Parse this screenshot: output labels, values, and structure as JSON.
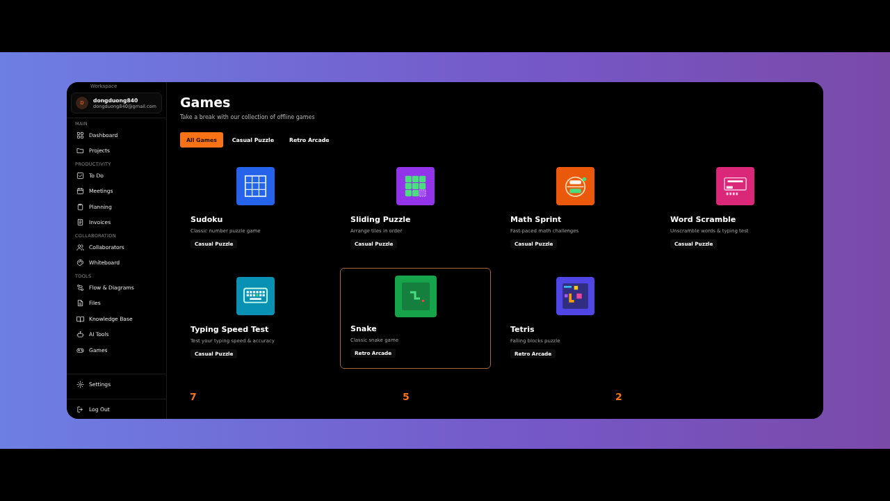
{
  "sidebar": {
    "workspace_label": "Workspace",
    "user": {
      "initial": "D",
      "name": "dongduong840",
      "email": "dongduong840@gmail.com"
    },
    "sections": [
      {
        "title": "MAIN",
        "items": [
          {
            "label": "Dashboard",
            "selected": false
          },
          {
            "label": "Projects",
            "selected": false
          }
        ]
      },
      {
        "title": "PRODUCTIVITY",
        "items": [
          {
            "label": "To Do",
            "selected": false
          },
          {
            "label": "Meetings",
            "selected": false
          },
          {
            "label": "Planning",
            "selected": false
          },
          {
            "label": "Invoices",
            "selected": false
          }
        ]
      },
      {
        "title": "COLLABORATION",
        "items": [
          {
            "label": "Collaborators",
            "selected": false
          },
          {
            "label": "Whiteboard",
            "selected": false
          }
        ]
      },
      {
        "title": "TOOLS",
        "items": [
          {
            "label": "Flow & Diagrams",
            "selected": false
          },
          {
            "label": "Files",
            "selected": false
          },
          {
            "label": "Knowledge Base",
            "selected": false
          },
          {
            "label": "AI Tools",
            "selected": false
          },
          {
            "label": "Games",
            "selected": false
          }
        ]
      }
    ],
    "settings": {
      "label": "Settings"
    },
    "logout": {
      "label": "Log Out"
    }
  },
  "page": {
    "title": "Games",
    "subtitle": "Take a break with our collection of offline games"
  },
  "tabs": [
    {
      "label": "All Games",
      "selected": true
    },
    {
      "label": "Casual Puzzle",
      "selected": false
    },
    {
      "label": "Retro Arcade",
      "selected": false
    }
  ],
  "games": [
    {
      "kind": "sudoku",
      "color": "#2563eb",
      "title": "Sudoku",
      "description": "Classic number puzzle game",
      "tag": "Casual Puzzle",
      "hovered": false
    },
    {
      "kind": "sliding",
      "color": "#9333ea",
      "title": "Sliding Puzzle",
      "description": "Arrange tiles in order",
      "tag": "Casual Puzzle",
      "hovered": false
    },
    {
      "kind": "math",
      "color": "#ea580c",
      "title": "Math Sprint",
      "description": "Fast-paced math challenges",
      "tag": "Casual Puzzle",
      "hovered": false
    },
    {
      "kind": "word",
      "color": "#db2777",
      "title": "Word Scramble",
      "description": "Unscramble words & typing test",
      "tag": "Casual Puzzle",
      "hovered": false
    },
    {
      "kind": "typing",
      "color": "#0891b2",
      "title": "Typing Speed Test",
      "description": "Test your typing speed & accuracy",
      "tag": "Casual Puzzle",
      "hovered": false
    },
    {
      "kind": "snake",
      "color": "#16a34a",
      "title": "Snake",
      "description": "Classic snake game",
      "tag": "Retro Arcade",
      "hovered": true
    },
    {
      "kind": "tetris",
      "color": "#4f46e5",
      "title": "Tetris",
      "description": "Falling blocks puzzle",
      "tag": "Retro Arcade",
      "hovered": false
    }
  ],
  "stats": [
    {
      "value": "7"
    },
    {
      "value": "5"
    },
    {
      "value": "2"
    }
  ]
}
